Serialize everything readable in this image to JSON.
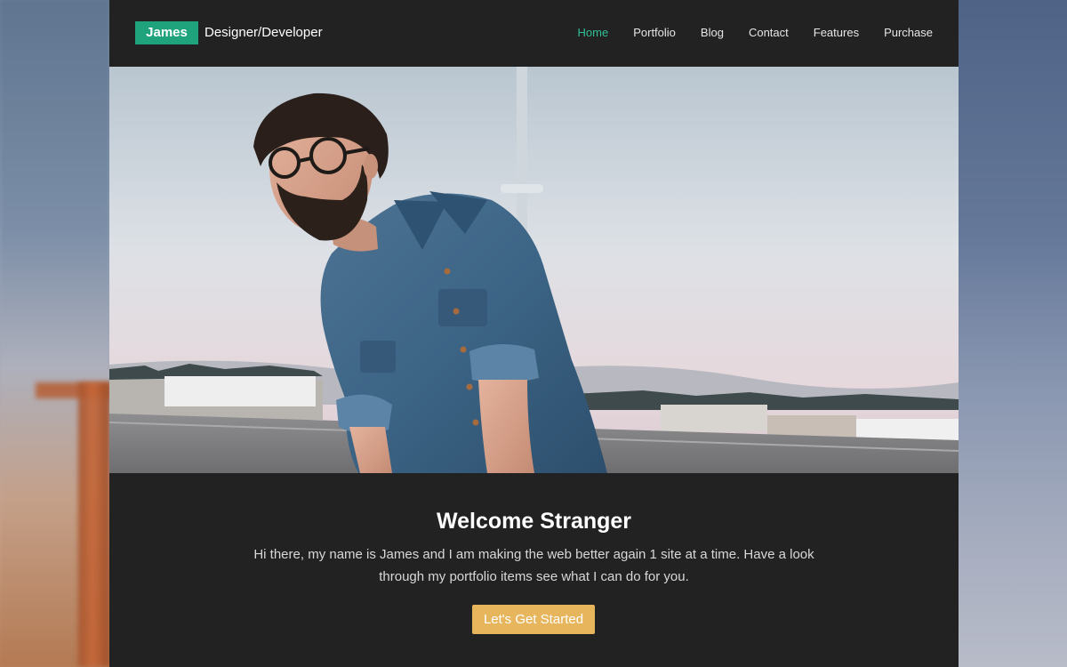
{
  "header": {
    "brand_name": "James",
    "brand_tagline": "Designer/Developer",
    "nav": [
      {
        "label": "Home",
        "active": true
      },
      {
        "label": "Portfolio",
        "active": false
      },
      {
        "label": "Blog",
        "active": false
      },
      {
        "label": "Contact",
        "active": false
      },
      {
        "label": "Features",
        "active": false
      },
      {
        "label": "Purchase",
        "active": false
      }
    ]
  },
  "hero": {
    "image_alt": "Bearded man with glasses in a denim shirt on a rooftop parking lot"
  },
  "main": {
    "headline": "Welcome Stranger",
    "intro": "Hi there, my name is James and I am making the web better again 1 site at a time. Have a look through my portfolio items see what I can do for you.",
    "cta_label": "Let's Get Started"
  },
  "colors": {
    "page_background": "#222222",
    "brand_accent": "#1fa37d",
    "nav_active": "#2fbf97",
    "cta_background": "#e7b55c"
  }
}
